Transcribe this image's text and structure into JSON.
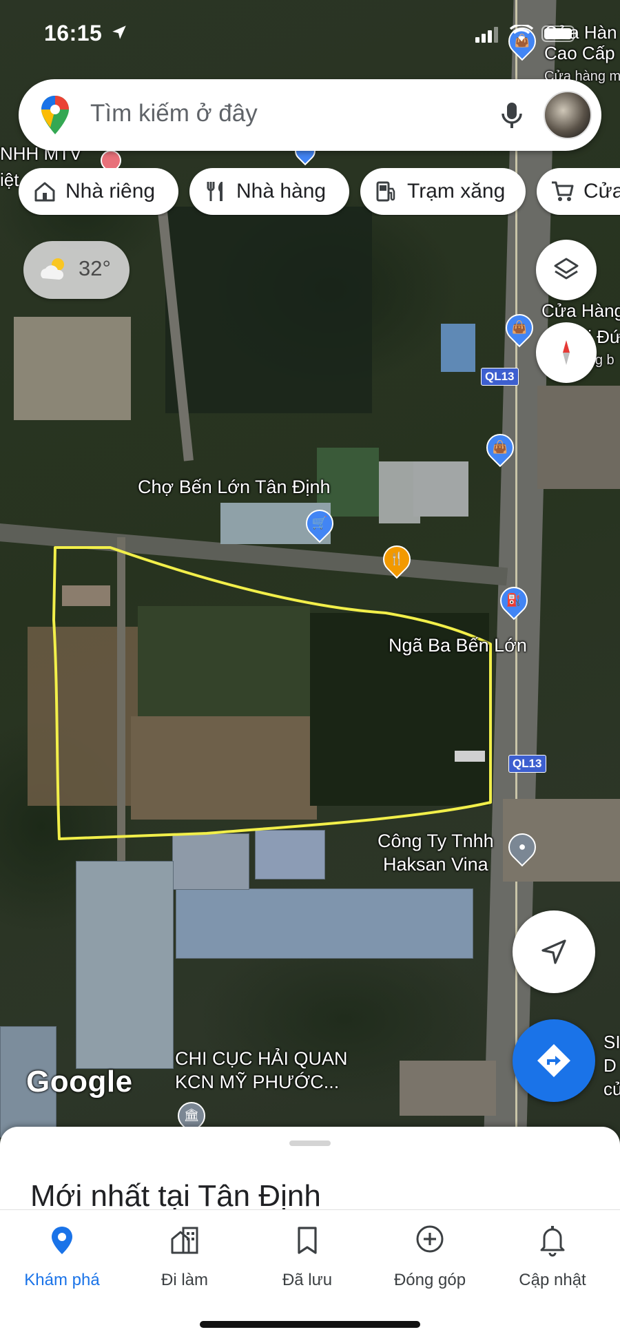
{
  "status_bar": {
    "time": "16:15"
  },
  "search": {
    "placeholder": "Tìm kiếm ở đây"
  },
  "chips": [
    {
      "label": "Nhà riêng",
      "icon": "home-icon"
    },
    {
      "label": "Nhà hàng",
      "icon": "restaurant-icon"
    },
    {
      "label": "Trạm xăng",
      "icon": "gas-station-icon"
    },
    {
      "label": "Cửa",
      "icon": "shopping-cart-icon"
    }
  ],
  "weather": {
    "temp": "32°"
  },
  "map_labels": {
    "top_right_store": "Cửa Hàn\nCao Cấp",
    "top_right_store_sub": "Cửa hàng m",
    "store_mid": "Cửa Hàng",
    "store_mid_sub": "Đại Đức T",
    "store_mid_sub2": "Cửa hàng b",
    "nhh_mtv": "NHH MTV",
    "viet": "iệt",
    "market": "Chợ Bến Lớn Tân Định",
    "junction": "Ngã Ba Bến Lớn",
    "company": "Công Ty Tnhh\nHaksan Vina",
    "customs": "CHI CỤC HẢI QUAN\nKCN MỸ PHƯỚC...",
    "right_edge": "SI\nD\ncủ",
    "road_shield_1": "QL13",
    "road_shield_2": "QL13"
  },
  "map": {
    "attribution": "Google",
    "highlight_color": "#f2ef4a"
  },
  "sheet": {
    "title": "Mới nhất tại Tân Định"
  },
  "nav": [
    {
      "label": "Khám phá",
      "icon": "explore-pin-icon",
      "active": true
    },
    {
      "label": "Đi làm",
      "icon": "commute-icon",
      "active": false
    },
    {
      "label": "Đã lưu",
      "icon": "bookmark-icon",
      "active": false
    },
    {
      "label": "Đóng góp",
      "icon": "add-circle-icon",
      "active": false
    },
    {
      "label": "Cập nhật",
      "icon": "bell-icon",
      "active": false
    }
  ],
  "colors": {
    "accent": "#1a73e8",
    "pin_blue": "#4285f4",
    "pin_orange": "#f29900",
    "pin_gray": "#7b8794"
  }
}
